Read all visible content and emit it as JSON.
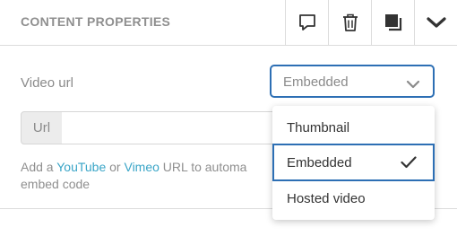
{
  "header": {
    "title": "CONTENT PROPERTIES",
    "buttons": [
      {
        "name": "comment",
        "icon": "comment-icon"
      },
      {
        "name": "delete",
        "icon": "trash-icon"
      },
      {
        "name": "duplicate",
        "icon": "copy-icon"
      },
      {
        "name": "collapse",
        "icon": "chevron-down-icon"
      }
    ]
  },
  "video": {
    "label": "Video url",
    "selected": "Embedded",
    "options": [
      "Thumbnail",
      "Embedded",
      "Hosted video"
    ]
  },
  "url": {
    "addon": "Url",
    "value": ""
  },
  "help": {
    "prefix": "Add a ",
    "youtube": "YouTube",
    "or": " or ",
    "vimeo": "Vimeo",
    "suffix": " URL to automa",
    "line2": "embed code"
  },
  "colors": {
    "accent": "#2d6fb4",
    "link": "#3aa5c7",
    "muted_text": "#8a8a8a"
  }
}
